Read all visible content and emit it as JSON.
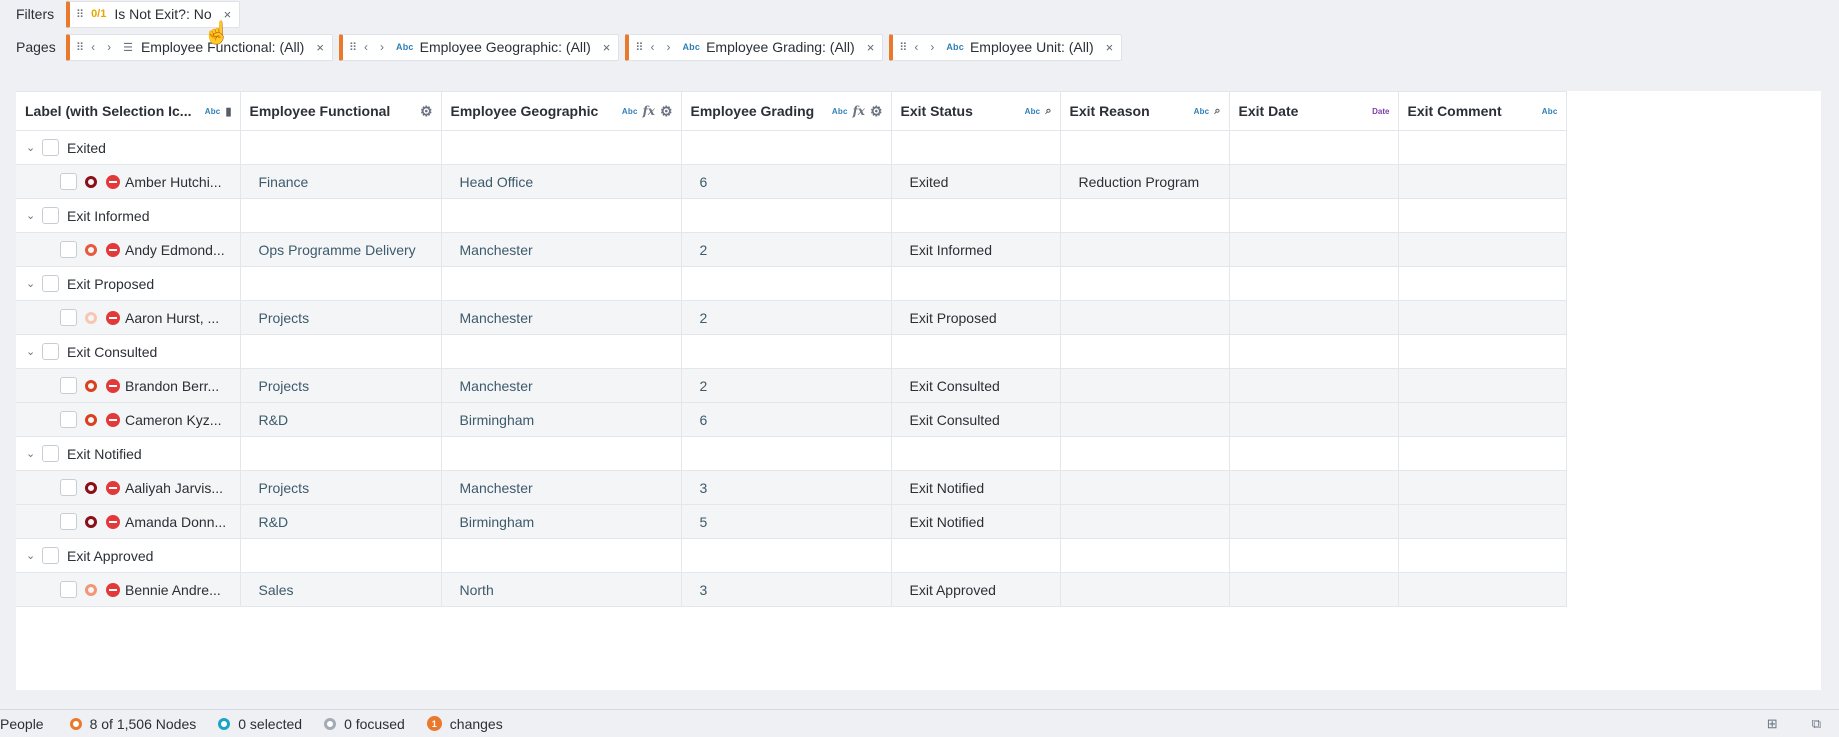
{
  "filters": {
    "label": "Filters",
    "chips": [
      {
        "badge": "0/1",
        "text": "Is Not Exit?: No",
        "close": "×"
      }
    ]
  },
  "pages": {
    "label": "Pages",
    "chips": [
      {
        "type": "list",
        "text": "Employee Functional: (All)",
        "close": "×"
      },
      {
        "type": "Abc",
        "text": "Employee Geographic: (All)",
        "close": "×"
      },
      {
        "type": "Abc",
        "text": "Employee Grading: (All)",
        "close": "×"
      },
      {
        "type": "Abc",
        "text": "Employee Unit: (All)",
        "close": "×"
      }
    ]
  },
  "grid": {
    "columns": [
      {
        "label": "Label (with Selection Ic...",
        "type": "Abc"
      },
      {
        "label": "Employee Functional"
      },
      {
        "label": "Employee Geographic",
        "type": "Abc"
      },
      {
        "label": "Employee Grading",
        "type": "Abc"
      },
      {
        "label": "Exit Status",
        "type": "Abc"
      },
      {
        "label": "Exit Reason",
        "type": "Abc"
      },
      {
        "label": "Exit Date",
        "type": "Date"
      },
      {
        "label": "Exit Comment",
        "type": "Abc"
      }
    ],
    "rows": [
      {
        "kind": "group",
        "label": "Exited"
      },
      {
        "kind": "item",
        "ring": "dark",
        "name": "Amber Hutchi...",
        "functional": "Finance",
        "geographic": "Head Office",
        "grading": "6",
        "status": "Exited",
        "reason": "Reduction Program",
        "date": "",
        "comment": ""
      },
      {
        "kind": "group",
        "label": "Exit Informed"
      },
      {
        "kind": "item",
        "ring": "mid",
        "name": "Andy Edmond...",
        "functional": "Ops Programme Delivery",
        "geographic": "Manchester",
        "grading": "2",
        "status": "Exit Informed",
        "reason": "",
        "date": "",
        "comment": ""
      },
      {
        "kind": "group",
        "label": "Exit Proposed"
      },
      {
        "kind": "item",
        "ring": "light",
        "name": "Aaron Hurst, ...",
        "functional": "Projects",
        "geographic": "Manchester",
        "grading": "2",
        "status": "Exit Proposed",
        "reason": "",
        "date": "",
        "comment": ""
      },
      {
        "kind": "group",
        "label": "Exit Consulted"
      },
      {
        "kind": "item",
        "ring": "base",
        "name": "Brandon Berr...",
        "functional": "Projects",
        "geographic": "Manchester",
        "grading": "2",
        "status": "Exit Consulted",
        "reason": "",
        "date": "",
        "comment": ""
      },
      {
        "kind": "item",
        "ring": "base",
        "name": "Cameron Kyz...",
        "functional": "R&D",
        "geographic": "Birmingham",
        "grading": "6",
        "status": "Exit Consulted",
        "reason": "",
        "date": "",
        "comment": ""
      },
      {
        "kind": "group",
        "label": "Exit Notified"
      },
      {
        "kind": "item",
        "ring": "dark",
        "name": "Aaliyah Jarvis...",
        "functional": "Projects",
        "geographic": "Manchester",
        "grading": "3",
        "status": "Exit Notified",
        "reason": "",
        "date": "",
        "comment": ""
      },
      {
        "kind": "item",
        "ring": "dark",
        "name": "Amanda Donn...",
        "functional": "R&D",
        "geographic": "Birmingham",
        "grading": "5",
        "status": "Exit Notified",
        "reason": "",
        "date": "",
        "comment": ""
      },
      {
        "kind": "group",
        "label": "Exit Approved"
      },
      {
        "kind": "item",
        "ring": "salmon",
        "name": "Bennie Andre...",
        "functional": "Sales",
        "geographic": "North",
        "grading": "3",
        "status": "Exit Approved",
        "reason": "",
        "date": "",
        "comment": ""
      }
    ]
  },
  "status_bar": {
    "context": "People",
    "nodes": "8 of 1,506 Nodes",
    "selected": "0 selected",
    "focused": "0 focused",
    "changes_count": "1",
    "changes": "changes"
  },
  "colors": {
    "accent": "#e8792d",
    "ring_base": "#d9401e",
    "ring_dark": "#8a0f16",
    "no_entry": "#e23a3a",
    "selected": "#1ba4c4"
  }
}
